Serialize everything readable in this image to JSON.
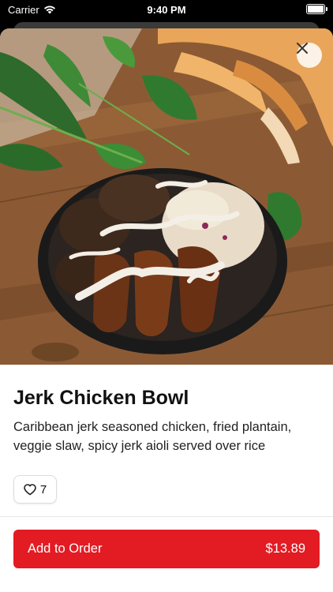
{
  "status_bar": {
    "carrier": "Carrier",
    "time": "9:40 PM"
  },
  "item": {
    "title": "Jerk Chicken Bowl",
    "description": "Caribbean jerk seasoned chicken, fried plantain, veggie slaw, spicy jerk aioli served over rice",
    "likes": "7"
  },
  "order_button": {
    "label": "Add to Order",
    "price": "$13.89"
  },
  "colors": {
    "accent": "#e31b23"
  },
  "icons": {
    "close": "close-icon",
    "like": "heart-icon",
    "wifi": "wifi-icon",
    "battery": "battery-icon"
  }
}
